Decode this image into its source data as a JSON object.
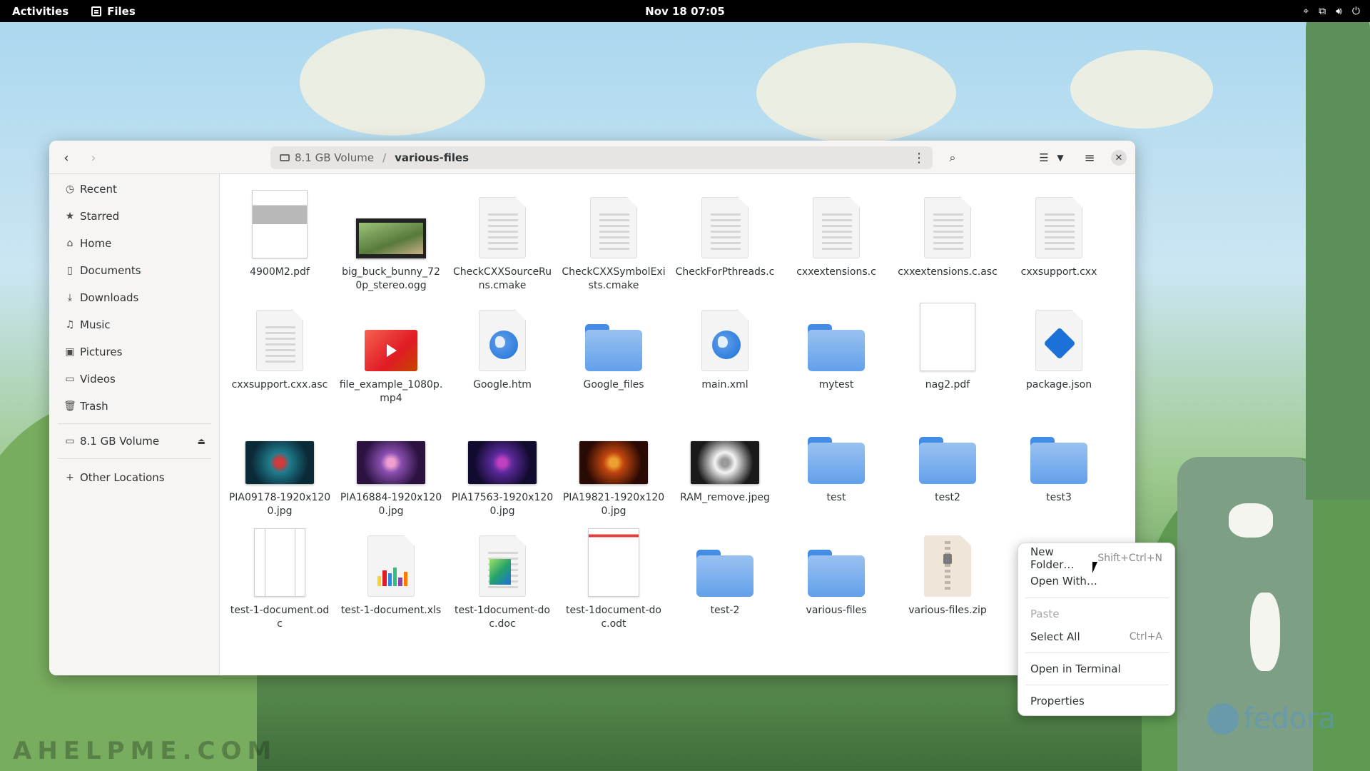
{
  "topbar": {
    "activities": "Activities",
    "app_name": "Files",
    "clock": "Nov 18  07:05",
    "tray_icons": [
      "location-icon",
      "network-icon",
      "volume-icon",
      "power-icon"
    ]
  },
  "window": {
    "path": {
      "volume": "8.1 GB Volume",
      "separator": "/",
      "current": "various-files"
    },
    "buttons": {
      "back": "back-icon",
      "forward": "forward-icon",
      "search": "search-icon",
      "view": "list-view-icon",
      "menu": "hamburger-menu-icon",
      "close": "close-icon"
    }
  },
  "sidebar": {
    "items": [
      {
        "label": "Recent",
        "icon": "clock-icon"
      },
      {
        "label": "Starred",
        "icon": "star-icon"
      },
      {
        "label": "Home",
        "icon": "home-icon"
      },
      {
        "label": "Documents",
        "icon": "document-icon"
      },
      {
        "label": "Downloads",
        "icon": "download-icon"
      },
      {
        "label": "Music",
        "icon": "music-icon"
      },
      {
        "label": "Pictures",
        "icon": "picture-icon"
      },
      {
        "label": "Videos",
        "icon": "video-icon"
      },
      {
        "label": "Trash",
        "icon": "trash-icon"
      }
    ],
    "volume": "8.1 GB Volume",
    "other_locations": "Other Locations"
  },
  "files": [
    {
      "name": "4900M2.pdf",
      "kind": "pdf-thumb"
    },
    {
      "name": "big_buck_bunny_720p_stereo.ogg",
      "kind": "video-thumb"
    },
    {
      "name": "CheckCXXSourceRuns.cmake",
      "kind": "text"
    },
    {
      "name": "CheckCXXSymbolExists.cmake",
      "kind": "text"
    },
    {
      "name": "CheckForPthreads.c",
      "kind": "text"
    },
    {
      "name": "cxxextensions.c",
      "kind": "text"
    },
    {
      "name": "cxxextensions.c.asc",
      "kind": "text"
    },
    {
      "name": "cxxsupport.cxx",
      "kind": "text"
    },
    {
      "name": "cxxsupport.cxx.asc",
      "kind": "text"
    },
    {
      "name": "file_example_1080p.mp4",
      "kind": "mp4"
    },
    {
      "name": "Google.htm",
      "kind": "html"
    },
    {
      "name": "Google_files",
      "kind": "folder"
    },
    {
      "name": "main.xml",
      "kind": "html"
    },
    {
      "name": "mytest",
      "kind": "folder"
    },
    {
      "name": "nag2.pdf",
      "kind": "pdf-blank"
    },
    {
      "name": "package.json",
      "kind": "json"
    },
    {
      "name": "PIA09178-1920x1200.jpg",
      "kind": "photo",
      "colors": [
        "#0b2a38",
        "#1e7c8c",
        "#d23b3b"
      ]
    },
    {
      "name": "PIA16884-1920x1200.jpg",
      "kind": "photo",
      "colors": [
        "#2b1240",
        "#8a4fb0",
        "#f0a0d0"
      ]
    },
    {
      "name": "PIA17563-1920x1200.jpg",
      "kind": "photo",
      "colors": [
        "#120b30",
        "#5a2a9a",
        "#c040c0"
      ]
    },
    {
      "name": "PIA19821-1920x1200.jpg",
      "kind": "photo",
      "colors": [
        "#2a0a04",
        "#c0450f",
        "#f0a030"
      ]
    },
    {
      "name": "RAM_remove.jpeg",
      "kind": "photo",
      "colors": [
        "#1a1a1a",
        "#f4f4f4",
        "#9a9a9a"
      ]
    },
    {
      "name": "test",
      "kind": "folder"
    },
    {
      "name": "test2",
      "kind": "folder"
    },
    {
      "name": "test3",
      "kind": "folder"
    },
    {
      "name": "test-1-document.odc",
      "kind": "page-chart"
    },
    {
      "name": "test-1-document.xls",
      "kind": "xls"
    },
    {
      "name": "test-1document-doc.doc",
      "kind": "doc-gradient"
    },
    {
      "name": "test-1document-doc.odt",
      "kind": "page-text"
    },
    {
      "name": "test-2",
      "kind": "folder"
    },
    {
      "name": "various-files",
      "kind": "folder"
    },
    {
      "name": "various-files.zip",
      "kind": "zip"
    }
  ],
  "context_menu": {
    "items": [
      {
        "label": "New Folder…",
        "accel": "Shift+Ctrl+N",
        "enabled": true
      },
      {
        "label": "Open With…",
        "accel": "",
        "enabled": true
      },
      {
        "label": "Paste",
        "accel": "",
        "enabled": false
      },
      {
        "label": "Select All",
        "accel": "Ctrl+A",
        "enabled": true
      },
      {
        "label": "Open in Terminal",
        "accel": "",
        "enabled": true
      },
      {
        "label": "Properties",
        "accel": "",
        "enabled": true
      }
    ]
  },
  "wallpaper": {
    "watermark": "AHELPME.COM",
    "brand": "fedora"
  },
  "colors": {
    "folder": "#62a0ea",
    "accent": "#1c71d8"
  }
}
